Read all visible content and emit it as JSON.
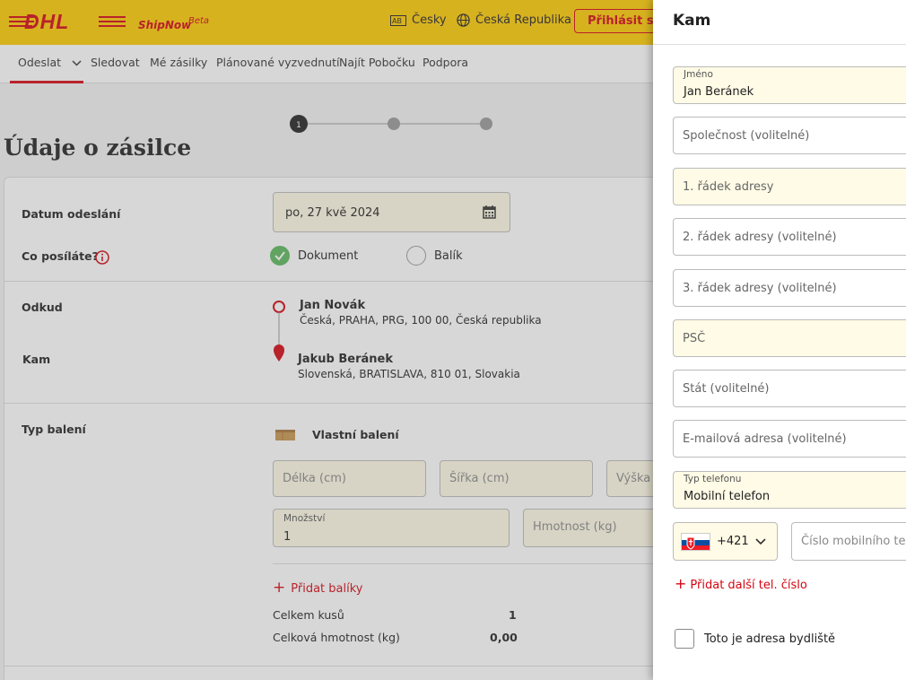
{
  "header": {
    "brand": "DHL",
    "product": "ShipNow",
    "beta": "Beta",
    "language": "Česky",
    "country": "Česká Republika",
    "login": "Přihlásit se"
  },
  "nav": {
    "items": [
      "Odeslat",
      "Sledovat",
      "Mé zásilky",
      "Plánované vyzvednutí",
      "Najít Pobočku",
      "Podpora"
    ]
  },
  "stepper": {
    "current": "1"
  },
  "form": {
    "title": "Údaje o zásilce",
    "ship_date_label": "Datum odeslání",
    "ship_date_value": "po, 27 kvě 2024",
    "what_label": "Co posíláte?",
    "option_document": "Dokument",
    "option_package": "Balík",
    "from_label": "Odkud",
    "from_name": "Jan Novák",
    "from_address": "Česká, PRAHA, PRG, 100 00, Česká republika",
    "to_label": "Kam",
    "to_name": "Jakub Beránek",
    "to_address": "Slovenská, BRATISLAVA, 810 01, Slovakia",
    "pack_label": "Typ balení",
    "pack_value": "Vlastní balení",
    "length_ph": "Délka (cm)",
    "width_ph": "Šířka (cm)",
    "height_ph": "Výška",
    "qty_label": "Množství",
    "qty_value": "1",
    "weight_ph": "Hmotnost (kg)",
    "add_packages": "Přidat balíky",
    "total_pieces_label": "Celkem kusů",
    "total_pieces_value": "1",
    "total_weight_label": "Celková hmotnost (kg)",
    "total_weight_value": "0,00"
  },
  "panel": {
    "title": "Kam",
    "name_label": "Jméno",
    "name_value": "Jan Beránek",
    "company_ph": "Společnost (volitelné)",
    "addr1_ph": "1. řádek adresy",
    "addr2_ph": "2. řádek adresy (volitelné)",
    "addr3_ph": "3. řádek adresy (volitelné)",
    "zip_ph": "PSČ",
    "state_ph": "Stát (volitelné)",
    "email_ph": "E-mailová adresa (volitelné)",
    "phone_type_label": "Typ telefonu",
    "phone_type_value": "Mobilní telefon",
    "country_code": "+421",
    "phone_ph": "Číslo mobilního telefonu",
    "add_phone": "Přidat další tel. číslo",
    "residence_label": "Toto je adresa bydliště"
  },
  "colors": {
    "brand_yellow": "#ffcc00",
    "brand_red": "#d40511",
    "check_green": "#5cb85c"
  }
}
